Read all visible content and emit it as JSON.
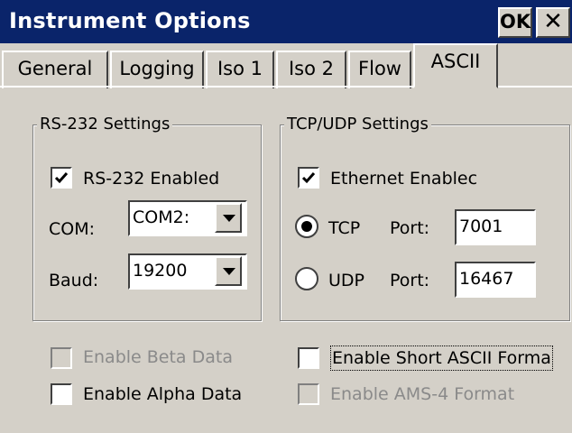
{
  "window": {
    "title": "Instrument Options",
    "ok_label": "OK",
    "close_glyph": "✕"
  },
  "tabs": [
    {
      "label": "General",
      "active": false
    },
    {
      "label": "Logging",
      "active": false
    },
    {
      "label": "Iso 1",
      "active": false
    },
    {
      "label": "Iso 2",
      "active": false
    },
    {
      "label": "Flow",
      "active": false
    },
    {
      "label": "ASCII",
      "active": true
    }
  ],
  "rs232": {
    "group_label": "RS-232 Settings",
    "enabled_label": "RS-232 Enabled",
    "enabled": true,
    "com_label": "COM:",
    "com_value": "COM2:",
    "baud_label": "Baud:",
    "baud_value": "19200"
  },
  "tcpudp": {
    "group_label": "TCP/UDP Settings",
    "ethernet_label": "Ethernet Enablec",
    "ethernet_enabled": true,
    "tcp_label": "TCP",
    "tcp_port_label": "Port:",
    "tcp_port": "7001",
    "udp_label": "UDP",
    "udp_port_label": "Port:",
    "udp_port": "16467",
    "selected_protocol": "TCP"
  },
  "options": {
    "beta_label": "Enable Beta Data",
    "beta_enabled": false,
    "beta_disabled": true,
    "alpha_label": "Enable Alpha Data",
    "alpha_enabled": false,
    "short_ascii_label": "Enable Short ASCII Forma",
    "short_ascii_enabled": false,
    "ams4_label": "Enable AMS-4 Format",
    "ams4_enabled": false,
    "ams4_disabled": true
  },
  "icons": {
    "check": "check-icon",
    "dropdown": "chevron-down-icon"
  },
  "colors": {
    "titlebar": "#0a246a",
    "face": "#d4d0c8",
    "disabled_text": "#8a8a8a"
  }
}
